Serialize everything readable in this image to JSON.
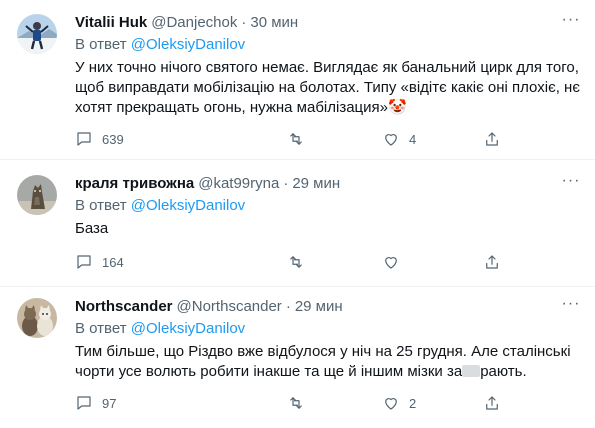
{
  "reply_prefix": "В ответ",
  "tweets": [
    {
      "name": "Vitalii Huk",
      "handle": "@Danjechok",
      "separator": "·",
      "time": "30 мин",
      "reply_to": "@OleksiyDanilov",
      "text": "У них точно нічого святого немає. Виглядає як банальний цирк для того, щоб виправдати мобілізацію на болотах. Типу «відітє какіє оні плохіє, нє хотят прекращать огонь, нужна мабілізация»",
      "emoji": "🤡",
      "replies": "639",
      "retweets": "",
      "likes": "4",
      "avatar_icon": "skier-photo-icon"
    },
    {
      "name": "краля тривожна",
      "handle": "@kat99ryna",
      "separator": "·",
      "time": "29 мин",
      "reply_to": "@OleksiyDanilov",
      "text": "База",
      "replies": "164",
      "retweets": "",
      "likes": "",
      "avatar_icon": "cat-statue-photo-icon"
    },
    {
      "name": "Northscander",
      "handle": "@Northscander",
      "separator": "·",
      "time": "29 мин",
      "reply_to": "@OleksiyDanilov",
      "text_before": "Тим більше, що Різдво вже відбулося у ніч на 25 грудня. Але сталінські чорти усе волють робити інакше та ще й іншим мізки за",
      "text_after": "рають.",
      "replies": "97",
      "retweets": "",
      "likes": "2",
      "avatar_icon": "cats-photo-icon"
    }
  ],
  "colors": {
    "link": "#1d9bf0",
    "muted": "#536471",
    "text": "#0f1419"
  }
}
